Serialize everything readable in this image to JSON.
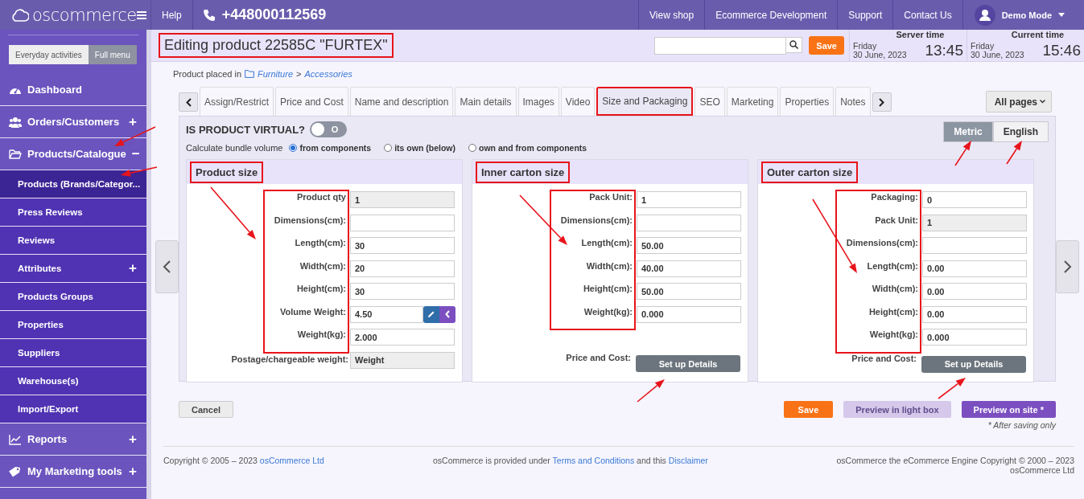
{
  "topbar": {
    "logo": "oscommerce",
    "help": "Help",
    "phone": "+448000112569",
    "links": [
      "View shop",
      "Ecommerce Development",
      "Support",
      "Contact Us"
    ],
    "user": "Demo Mode"
  },
  "sidebar": {
    "modes": [
      {
        "label": "Everyday activities",
        "selected": false
      },
      {
        "label": "Full menu",
        "selected": true
      }
    ],
    "items": [
      {
        "label": "Dashboard"
      },
      {
        "label": "Orders/Customers",
        "sign": "+"
      },
      {
        "label": "Products/Catalogue",
        "sign": "−",
        "children": [
          {
            "label": "Products (Brands/Categor...",
            "selected": true
          },
          {
            "label": "Press Reviews",
            "selected": false
          },
          {
            "label": "Reviews",
            "selected": false
          },
          {
            "label": "Attributes",
            "selected": false,
            "sign": "+"
          },
          {
            "label": "Products Groups",
            "selected": false
          },
          {
            "label": "Properties",
            "selected": false
          },
          {
            "label": "Suppliers",
            "selected": false
          },
          {
            "label": "Warehouse(s)",
            "selected": false
          },
          {
            "label": "Import/Export",
            "selected": false
          }
        ]
      },
      {
        "label": "Reports",
        "sign": "+"
      },
      {
        "label": "My Marketing tools",
        "sign": "+"
      }
    ]
  },
  "header": {
    "title": "Editing product 22585C \"FURTEX\"",
    "title_highlighted": true,
    "save": "Save",
    "clocks": [
      {
        "label": "Server time",
        "day": "Friday",
        "date": "30 June, 2023",
        "time": "13:45"
      },
      {
        "label": "Current time",
        "day": "Friday",
        "date": "30 June, 2023",
        "time": "15:46"
      }
    ]
  },
  "breadcrumb": {
    "prefix": "Product placed in",
    "path": [
      "Furniture",
      "Accessories"
    ],
    "separator": ">"
  },
  "tabs": [
    {
      "label": "Assign/Restrict",
      "selected": false,
      "highlighted": false
    },
    {
      "label": "Price and Cost",
      "selected": false,
      "highlighted": false
    },
    {
      "label": "Name and description",
      "selected": false,
      "highlighted": false
    },
    {
      "label": "Main details",
      "selected": false,
      "highlighted": false
    },
    {
      "label": "Images",
      "selected": false,
      "highlighted": false
    },
    {
      "label": "Video",
      "selected": false,
      "highlighted": false
    },
    {
      "label": "Size and Packaging",
      "selected": true,
      "highlighted": true
    },
    {
      "label": "SEO",
      "selected": false,
      "highlighted": false
    },
    {
      "label": "Marketing",
      "selected": false,
      "highlighted": false
    },
    {
      "label": "Properties",
      "selected": false,
      "highlighted": false
    },
    {
      "label": "Notes",
      "selected": false,
      "highlighted": false
    }
  ],
  "all_pages": "All pages",
  "virtual": {
    "label": "IS PRODUCT VIRTUAL?",
    "on": false,
    "toggle_text": "O"
  },
  "units": [
    {
      "label": "Metric",
      "selected": true
    },
    {
      "label": "English",
      "selected": false
    }
  ],
  "bundle": {
    "label": "Calculate bundle volume",
    "options": [
      {
        "label": "from components",
        "selected": true
      },
      {
        "label": "its own (below)",
        "selected": false
      },
      {
        "label": "own and from components",
        "selected": false
      }
    ]
  },
  "cards": [
    {
      "title": "Product size",
      "highlighted": true,
      "labels_highlighted": true,
      "fields": [
        {
          "label": "Product qty",
          "value": "1",
          "readonly": true,
          "kind": "input"
        },
        {
          "label": "Dimensions(cm):",
          "readonly": false,
          "kind": "input"
        },
        {
          "label": "Length(cm):",
          "value": "30",
          "readonly": false,
          "kind": "input"
        },
        {
          "label": "Width(cm):",
          "value": "20",
          "readonly": false,
          "kind": "input"
        },
        {
          "label": "Height(cm):",
          "value": "30",
          "readonly": false,
          "kind": "input"
        },
        {
          "label": "Volume Weight:",
          "value": "4.50",
          "readonly": false,
          "kind": "actions"
        },
        {
          "label": "Weight(kg):",
          "value": "2.000",
          "readonly": false,
          "kind": "input"
        }
      ],
      "extra_fields": [
        {
          "label": "Postage/chargeable weight:",
          "value": "Weight",
          "readonly": true
        }
      ]
    },
    {
      "title": "Inner carton size",
      "highlighted": true,
      "labels_highlighted": true,
      "fields": [
        {
          "label": "Pack Unit:",
          "value": "1",
          "readonly": false,
          "kind": "input"
        },
        {
          "label": "Dimensions(cm):",
          "readonly": false,
          "kind": "input"
        },
        {
          "label": "Length(cm):",
          "value": "50.00",
          "readonly": false,
          "kind": "input"
        },
        {
          "label": "Width(cm):",
          "value": "40.00",
          "readonly": false,
          "kind": "input"
        },
        {
          "label": "Height(cm):",
          "value": "50.00",
          "readonly": false,
          "kind": "input"
        },
        {
          "label": "Weight(kg):",
          "value": "0.000",
          "readonly": false,
          "kind": "input"
        }
      ],
      "price_label": "Price and Cost:",
      "button": "Set up Details"
    },
    {
      "title": "Outer carton size",
      "highlighted": true,
      "labels_highlighted": true,
      "fields": [
        {
          "label": "Packaging:",
          "value": "0",
          "readonly": false,
          "kind": "input"
        },
        {
          "label": "Pack Unit:",
          "value": "1",
          "readonly": true,
          "kind": "input"
        },
        {
          "label": "Dimensions(cm):",
          "readonly": false,
          "kind": "input"
        },
        {
          "label": "Length(cm):",
          "value": "0.00",
          "readonly": false,
          "kind": "input"
        },
        {
          "label": "Width(cm):",
          "value": "0.00",
          "readonly": false,
          "kind": "input"
        },
        {
          "label": "Height(cm):",
          "value": "0.00",
          "readonly": false,
          "kind": "input"
        },
        {
          "label": "Weight(kg):",
          "value": "0.000",
          "readonly": false,
          "kind": "input"
        }
      ],
      "price_label": "Price and Cost:",
      "button": "Set up Details"
    }
  ],
  "actions": {
    "cancel": "Cancel",
    "buttons": [
      {
        "label": "Save",
        "kind": "save",
        "disabled": false
      },
      {
        "label": "Preview in light box",
        "kind": "preview",
        "disabled": true
      },
      {
        "label": "Preview on site *",
        "kind": "site",
        "disabled": false
      }
    ],
    "note": "* After saving only"
  },
  "footer": [
    [
      {
        "text": "Copyright © 2005 – 2023 ",
        "kind": "text"
      },
      {
        "text": "osCommerce Ltd",
        "kind": "link"
      }
    ],
    [
      {
        "text": "osCommerce is provided under ",
        "kind": "text"
      },
      {
        "text": "Terms and Conditions",
        "kind": "link"
      },
      {
        "text": " and this ",
        "kind": "text"
      },
      {
        "text": "Disclaimer",
        "kind": "link"
      }
    ],
    [
      {
        "text": "osCommerce the eCommerce Engine Copyright © 2000 – 2023 osCommerce Ltd",
        "kind": "text"
      }
    ]
  ]
}
